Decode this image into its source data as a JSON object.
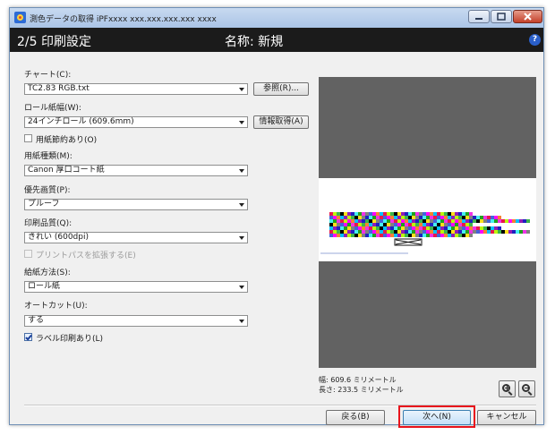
{
  "window": {
    "title": "測色データの取得 iPFxxxx xxx.xxx.xxx.xxx xxxx",
    "step": "2/5 印刷設定",
    "name": "名称: 新規",
    "help": "?"
  },
  "form": {
    "chart": {
      "label": "チャート(C):",
      "value": "TC2.83 RGB.txt",
      "button": "参照(R)..."
    },
    "roll_width": {
      "label": "ロール紙幅(W):",
      "value": "24インチロール (609.6mm)",
      "button": "情報取得(A)"
    },
    "paper_saving": {
      "label": "用紙節約あり(O)",
      "checked": false
    },
    "media_type": {
      "label": "用紙種類(M):",
      "value": "Canon 厚口コート紙"
    },
    "priority": {
      "label": "優先画質(P):",
      "value": "プルーフ"
    },
    "quality": {
      "label": "印刷品質(Q):",
      "value": "きれい (600dpi)"
    },
    "extend_pass": {
      "label": "プリントパスを拡張する(E)",
      "checked": false,
      "disabled": true
    },
    "feed": {
      "label": "給紙方法(S):",
      "value": "ロール紙"
    },
    "autocut": {
      "label": "オートカット(U):",
      "value": "する"
    },
    "label_print": {
      "label": "ラベル印刷あり(L)",
      "checked": true
    }
  },
  "preview": {
    "width_text": "幅: 609.6 ミリメートル",
    "length_text": "長さ: 233.5 ミリメートル",
    "zoom_in": "zoom-in-icon",
    "zoom_out": "zoom-out-icon"
  },
  "footer": {
    "back": "戻る(B)",
    "next": "次へ(N)",
    "cancel": "キャンセル"
  },
  "colors": {
    "header_bg": "#1b1b1b",
    "preview_bg": "#626262",
    "highlight": "#e8141c"
  }
}
